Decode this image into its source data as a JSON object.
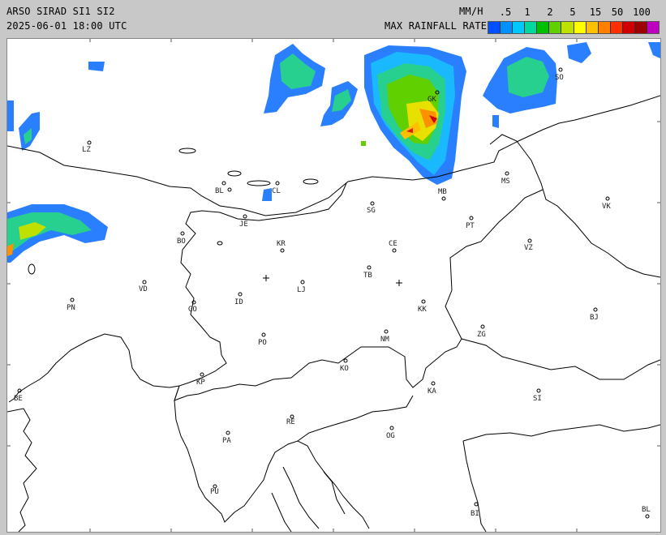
{
  "header": {
    "title": "ARSO SIRAD SI1 SI2",
    "timestamp": "2025-06-01 18:00 UTC",
    "unit": "MM/H",
    "legend_label": "MAX RAINFALL RATE"
  },
  "legend": {
    "ticks": [
      ".5",
      "1",
      "2",
      "5",
      "15",
      "50",
      "100"
    ],
    "colors": [
      "#0050ff",
      "#0090ff",
      "#00c8ff",
      "#00d8a0",
      "#00c000",
      "#60d000",
      "#c0e000",
      "#ffff00",
      "#ffc000",
      "#ff8000",
      "#ff3000",
      "#d00000",
      "#a00000",
      "#c000c0"
    ]
  },
  "map": {
    "cities": [
      {
        "code": "LZ"
      },
      {
        "code": "BL"
      },
      {
        "code": "CL"
      },
      {
        "code": "GK"
      },
      {
        "code": "MB"
      },
      {
        "code": "MS"
      },
      {
        "code": "SO"
      },
      {
        "code": "VK"
      },
      {
        "code": "SG"
      },
      {
        "code": "PT"
      },
      {
        "code": "JE"
      },
      {
        "code": "BO"
      },
      {
        "code": "KR"
      },
      {
        "code": "CE"
      },
      {
        "code": "VZ"
      },
      {
        "code": "TB"
      },
      {
        "code": "VD"
      },
      {
        "code": "LJ"
      },
      {
        "code": "PN"
      },
      {
        "code": "GO"
      },
      {
        "code": "ID"
      },
      {
        "code": "KK"
      },
      {
        "code": "BJ"
      },
      {
        "code": "PO"
      },
      {
        "code": "NM"
      },
      {
        "code": "ZG"
      },
      {
        "code": "KO"
      },
      {
        "code": "KP"
      },
      {
        "code": "KA"
      },
      {
        "code": "SI"
      },
      {
        "code": "BE"
      },
      {
        "code": "RE"
      },
      {
        "code": "PA"
      },
      {
        "code": "OG"
      },
      {
        "code": "PU"
      },
      {
        "code": "BI"
      },
      {
        "code": "BL"
      }
    ]
  }
}
